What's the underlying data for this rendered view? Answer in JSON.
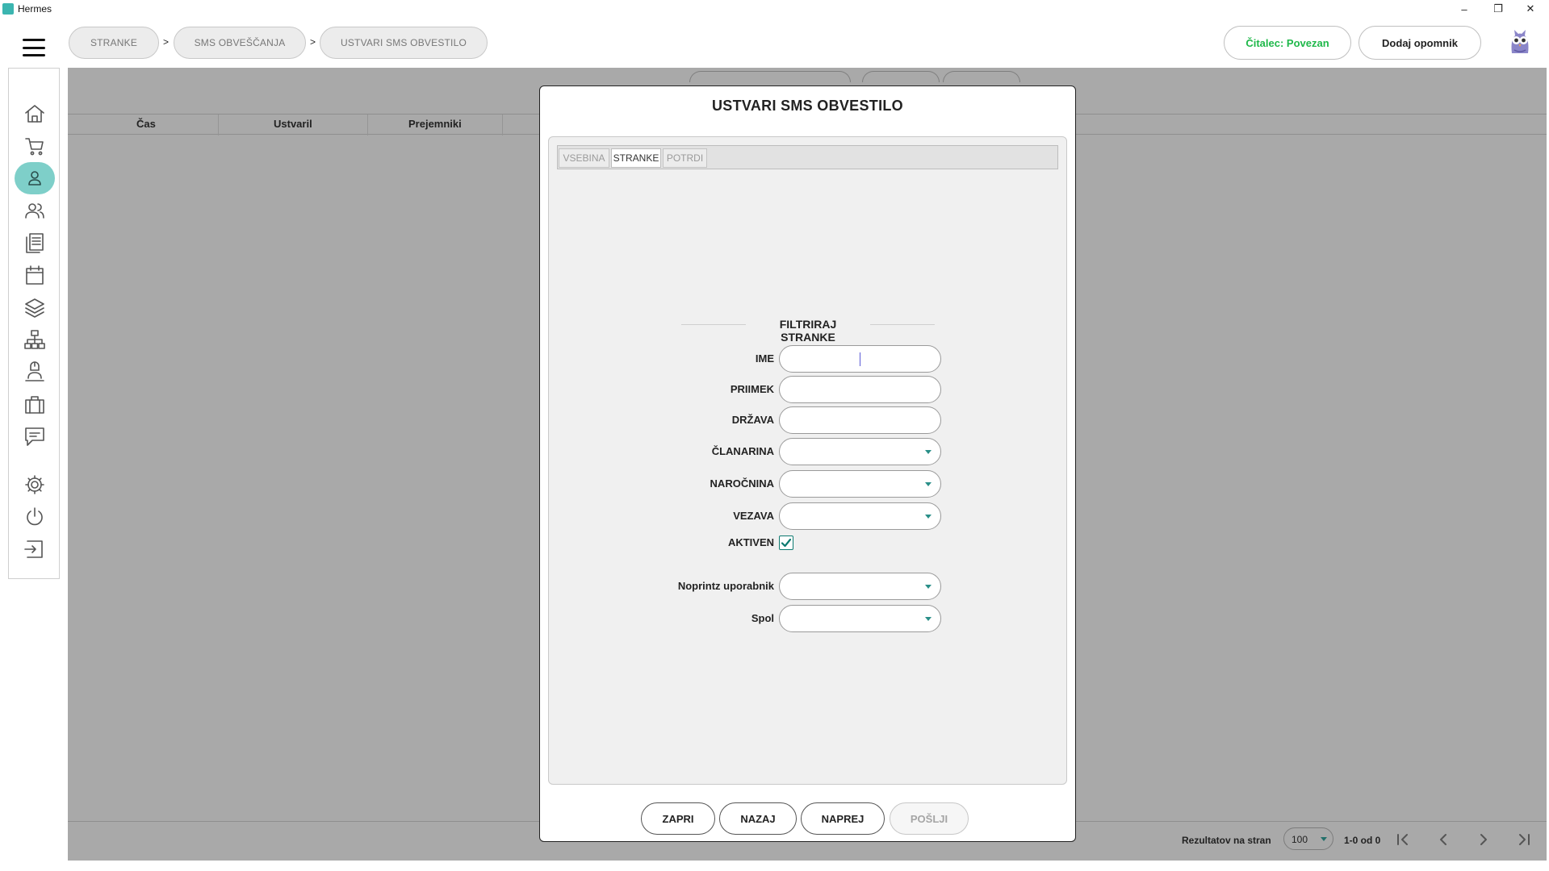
{
  "window": {
    "title": "Hermes",
    "minimize": "–",
    "restore": "❐",
    "close": "✕"
  },
  "breadcrumb": {
    "items": [
      {
        "label": "STRANKE"
      },
      {
        "label": "SMS OBVEŠČANJA"
      },
      {
        "label": "USTVARI SMS OBVESTILO"
      }
    ],
    "separator": ">"
  },
  "header": {
    "reader_status": "Čitalec: Povezan",
    "reader_status_color": "#1fb84a",
    "add_reminder": "Dodaj opomnik"
  },
  "sidebar": {
    "items": [
      {
        "icon": "home-icon"
      },
      {
        "icon": "cart-icon"
      },
      {
        "icon": "person-icon",
        "active": true
      },
      {
        "icon": "people-icon"
      },
      {
        "icon": "documents-icon"
      },
      {
        "icon": "calendar-icon"
      },
      {
        "icon": "layers-icon"
      },
      {
        "icon": "network-icon"
      },
      {
        "icon": "user-desk-icon"
      },
      {
        "icon": "briefcase-icon"
      },
      {
        "icon": "message-icon"
      },
      {
        "icon": "gear-icon"
      },
      {
        "icon": "power-icon"
      },
      {
        "icon": "logout-icon"
      }
    ],
    "active_color": "#7ecfc9"
  },
  "table": {
    "columns": [
      "Čas",
      "Ustvaril",
      "Prejemniki"
    ]
  },
  "pager": {
    "label": "Rezultatov na stran",
    "page_size": "100",
    "count": "1-0 od 0"
  },
  "modal": {
    "title": "USTVARI SMS OBVESTILO",
    "tabs": [
      {
        "label": "VSEBINA"
      },
      {
        "label": "STRANKE",
        "active": true
      },
      {
        "label": "POTRDI"
      }
    ],
    "section_title": "FILTRIRAJ STRANKE",
    "fields": {
      "ime": {
        "label": "IME",
        "value": ""
      },
      "priimek": {
        "label": "PRIIMEK",
        "value": ""
      },
      "drzava": {
        "label": "DRŽAVA",
        "value": ""
      },
      "clanarina": {
        "label": "ČLANARINA",
        "value": ""
      },
      "narocnina": {
        "label": "NAROČNINA",
        "value": ""
      },
      "vezava": {
        "label": "VEZAVA",
        "value": ""
      },
      "aktiven": {
        "label": "AKTIVEN",
        "checked": true
      },
      "noprintz": {
        "label": "Noprintz uporabnik",
        "value": ""
      },
      "spol": {
        "label": "Spol",
        "value": ""
      }
    },
    "buttons": {
      "close": "ZAPRI",
      "back": "NAZAJ",
      "next": "NAPREJ",
      "send": "POŠLJI"
    },
    "accent_color": "#0d7a70"
  }
}
